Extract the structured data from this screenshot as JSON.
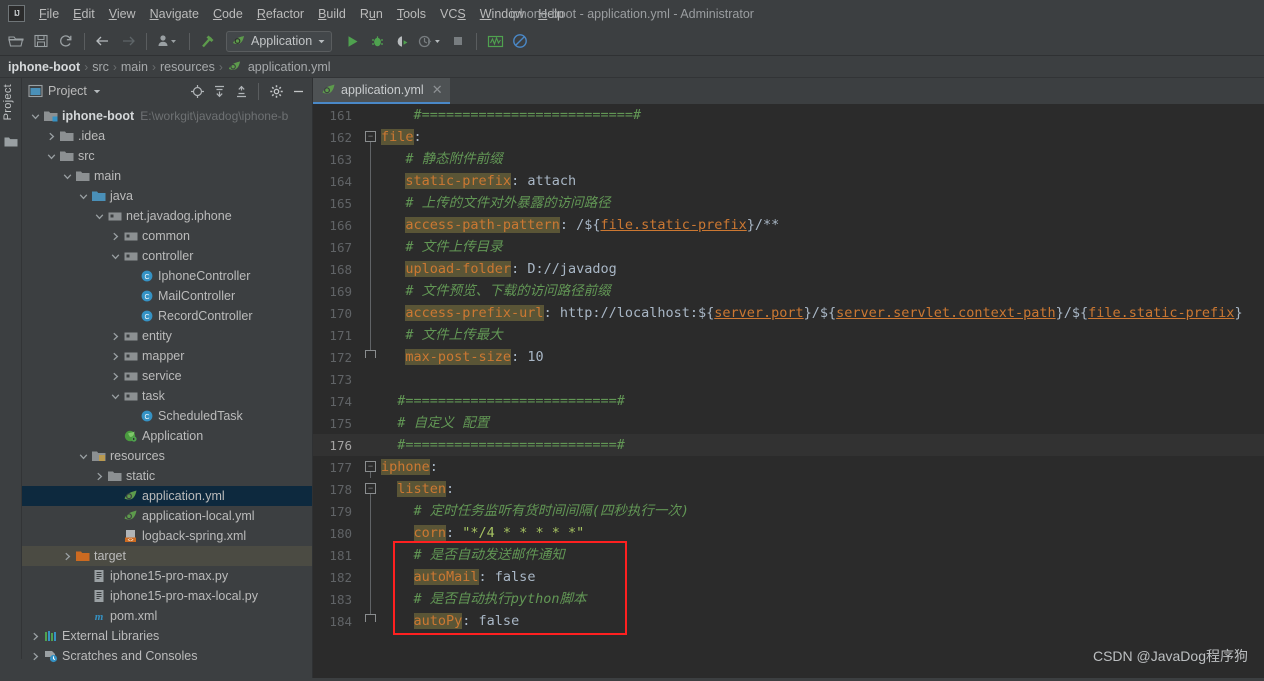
{
  "window": {
    "title": "iphone-boot - application.yml - Administrator"
  },
  "menubar": {
    "logo": "IJ",
    "items": [
      {
        "label": "File",
        "mnemonic": "F"
      },
      {
        "label": "Edit",
        "mnemonic": "E"
      },
      {
        "label": "View",
        "mnemonic": "V"
      },
      {
        "label": "Navigate",
        "mnemonic": "N"
      },
      {
        "label": "Code",
        "mnemonic": "C"
      },
      {
        "label": "Refactor",
        "mnemonic": "R"
      },
      {
        "label": "Build",
        "mnemonic": "B"
      },
      {
        "label": "Run",
        "mnemonic": "u"
      },
      {
        "label": "Tools",
        "mnemonic": "T"
      },
      {
        "label": "VCS",
        "mnemonic": "S"
      },
      {
        "label": "Window",
        "mnemonic": "W"
      },
      {
        "label": "Help",
        "mnemonic": "H"
      }
    ]
  },
  "toolbar": {
    "run_config": "Application",
    "icons": [
      "open-folder-icon",
      "save-all-icon",
      "sync-icon",
      "back-arrow-icon",
      "forward-arrow-icon",
      "profile-user-icon",
      "build-hammer-icon"
    ],
    "run_icons": [
      "run-icon",
      "debug-icon",
      "run-coverage-icon",
      "profiler-icon",
      "stop-icon",
      "monitor-icon",
      "no-entry-icon"
    ]
  },
  "breadcrumb": {
    "items": [
      "iphone-boot",
      "src",
      "main",
      "resources",
      "application.yml"
    ],
    "separator": "›",
    "file_icon": "yaml-leaf-icon"
  },
  "tool_strip": {
    "label": "Project",
    "icon": "folder-icon"
  },
  "project_panel": {
    "title": "Project",
    "dropdown_icon": "chevron-down-icon",
    "actions": [
      "locate-icon",
      "expand-all-icon",
      "collapse-all-icon",
      "settings-gear-icon",
      "hide-icon"
    ],
    "tree": [
      {
        "label": "iphone-boot",
        "path": "E:\\workgit\\javadog\\iphone-b",
        "depth": 0,
        "arrow": "down",
        "icon": "module-icon",
        "bold": true,
        "state": "normal"
      },
      {
        "label": ".idea",
        "depth": 1,
        "arrow": "right",
        "icon": "folder-icon",
        "state": "normal"
      },
      {
        "label": "src",
        "depth": 1,
        "arrow": "down",
        "icon": "folder-icon",
        "state": "normal"
      },
      {
        "label": "main",
        "depth": 2,
        "arrow": "down",
        "icon": "folder-icon",
        "state": "normal"
      },
      {
        "label": "java",
        "depth": 3,
        "arrow": "down",
        "icon": "source-folder-icon",
        "state": "normal"
      },
      {
        "label": "net.javadog.iphone",
        "depth": 4,
        "arrow": "down",
        "icon": "package-icon",
        "state": "normal"
      },
      {
        "label": "common",
        "depth": 5,
        "arrow": "right",
        "icon": "package-icon",
        "state": "normal"
      },
      {
        "label": "controller",
        "depth": 5,
        "arrow": "down",
        "icon": "package-icon",
        "state": "normal"
      },
      {
        "label": "IphoneController",
        "depth": 6,
        "arrow": "none",
        "icon": "java-class-icon",
        "state": "normal"
      },
      {
        "label": "MailController",
        "depth": 6,
        "arrow": "none",
        "icon": "java-class-icon",
        "state": "normal"
      },
      {
        "label": "RecordController",
        "depth": 6,
        "arrow": "none",
        "icon": "java-class-icon",
        "state": "normal"
      },
      {
        "label": "entity",
        "depth": 5,
        "arrow": "right",
        "icon": "package-icon",
        "state": "normal"
      },
      {
        "label": "mapper",
        "depth": 5,
        "arrow": "right",
        "icon": "package-icon",
        "state": "normal"
      },
      {
        "label": "service",
        "depth": 5,
        "arrow": "right",
        "icon": "package-icon",
        "state": "normal"
      },
      {
        "label": "task",
        "depth": 5,
        "arrow": "down",
        "icon": "package-icon",
        "state": "normal"
      },
      {
        "label": "ScheduledTask",
        "depth": 6,
        "arrow": "none",
        "icon": "java-class-icon",
        "state": "normal"
      },
      {
        "label": "Application",
        "depth": 5,
        "arrow": "none",
        "icon": "spring-boot-icon",
        "state": "normal"
      },
      {
        "label": "resources",
        "depth": 3,
        "arrow": "down",
        "icon": "resource-folder-icon",
        "state": "normal"
      },
      {
        "label": "static",
        "depth": 4,
        "arrow": "right",
        "icon": "folder-icon",
        "state": "normal"
      },
      {
        "label": "application.yml",
        "depth": 5,
        "arrow": "none",
        "icon": "yaml-leaf-icon",
        "state": "selected"
      },
      {
        "label": "application-local.yml",
        "depth": 5,
        "arrow": "none",
        "icon": "yaml-leaf-icon",
        "state": "normal"
      },
      {
        "label": "logback-spring.xml",
        "depth": 5,
        "arrow": "none",
        "icon": "xml-file-icon",
        "state": "normal"
      },
      {
        "label": "target",
        "depth": 2,
        "arrow": "right",
        "icon": "target-folder-icon",
        "state": "hover"
      },
      {
        "label": "iphone15-pro-max.py",
        "depth": 3,
        "arrow": "none",
        "icon": "python-file-icon",
        "state": "normal"
      },
      {
        "label": "iphone15-pro-max-local.py",
        "depth": 3,
        "arrow": "none",
        "icon": "python-file-icon",
        "state": "normal"
      },
      {
        "label": "pom.xml",
        "depth": 3,
        "arrow": "none",
        "icon": "maven-icon",
        "state": "normal"
      },
      {
        "label": "External Libraries",
        "depth": 0,
        "arrow": "right",
        "icon": "libraries-icon",
        "state": "normal"
      },
      {
        "label": "Scratches and Consoles",
        "depth": 0,
        "arrow": "right",
        "icon": "scratches-icon",
        "state": "normal"
      }
    ]
  },
  "editor": {
    "tabs": [
      {
        "label": "application.yml",
        "icon": "yaml-leaf-icon",
        "active": true,
        "close_icon": "close-icon"
      }
    ],
    "current_line": 176,
    "lines": [
      {
        "n": 161,
        "fold": "none",
        "tokens": [
          {
            "t": "    ",
            "c": "plain"
          },
          {
            "t": "#==========================#",
            "c": "com"
          }
        ]
      },
      {
        "n": 162,
        "fold": "open",
        "tokens": [
          {
            "t": "file",
            "c": "key"
          },
          {
            "t": ":",
            "c": "punc"
          }
        ]
      },
      {
        "n": 163,
        "fold": "line",
        "tokens": [
          {
            "t": "   ",
            "c": "plain"
          },
          {
            "t": "# 静态附件前缀",
            "c": "com"
          }
        ]
      },
      {
        "n": 164,
        "fold": "line",
        "tokens": [
          {
            "t": "   ",
            "c": "plain"
          },
          {
            "t": "static-prefix",
            "c": "key"
          },
          {
            "t": ": attach",
            "c": "plain"
          }
        ]
      },
      {
        "n": 165,
        "fold": "line",
        "tokens": [
          {
            "t": "   ",
            "c": "plain"
          },
          {
            "t": "# 上传的文件对外暴露的访问路径",
            "c": "com"
          }
        ]
      },
      {
        "n": 166,
        "fold": "line",
        "tokens": [
          {
            "t": "   ",
            "c": "plain"
          },
          {
            "t": "access-path-pattern",
            "c": "key"
          },
          {
            "t": ": /${",
            "c": "plain"
          },
          {
            "t": "file.static-prefix",
            "c": "var"
          },
          {
            "t": "}/**",
            "c": "plain"
          }
        ]
      },
      {
        "n": 167,
        "fold": "line",
        "tokens": [
          {
            "t": "   ",
            "c": "plain"
          },
          {
            "t": "# 文件上传目录",
            "c": "com"
          }
        ]
      },
      {
        "n": 168,
        "fold": "line",
        "tokens": [
          {
            "t": "   ",
            "c": "plain"
          },
          {
            "t": "upload-folder",
            "c": "key"
          },
          {
            "t": ": D://javadog",
            "c": "plain"
          }
        ]
      },
      {
        "n": 169,
        "fold": "line",
        "tokens": [
          {
            "t": "   ",
            "c": "plain"
          },
          {
            "t": "# 文件预览、下载的访问路径前缀",
            "c": "com"
          }
        ]
      },
      {
        "n": 170,
        "fold": "line",
        "tokens": [
          {
            "t": "   ",
            "c": "plain"
          },
          {
            "t": "access-prefix-url",
            "c": "key"
          },
          {
            "t": ": http://localhost:${",
            "c": "plain"
          },
          {
            "t": "server.port",
            "c": "var"
          },
          {
            "t": "}/${",
            "c": "plain"
          },
          {
            "t": "server.servlet.context-path",
            "c": "var"
          },
          {
            "t": "}/${",
            "c": "plain"
          },
          {
            "t": "file.static-prefix",
            "c": "var"
          },
          {
            "t": "}",
            "c": "plain"
          }
        ]
      },
      {
        "n": 171,
        "fold": "line",
        "tokens": [
          {
            "t": "   ",
            "c": "plain"
          },
          {
            "t": "# 文件上传最大",
            "c": "com"
          }
        ]
      },
      {
        "n": 172,
        "fold": "end",
        "tokens": [
          {
            "t": "   ",
            "c": "plain"
          },
          {
            "t": "max-post-size",
            "c": "key"
          },
          {
            "t": ": 10",
            "c": "plain"
          }
        ]
      },
      {
        "n": 173,
        "fold": "none",
        "tokens": []
      },
      {
        "n": 174,
        "fold": "none",
        "tokens": [
          {
            "t": "  ",
            "c": "plain"
          },
          {
            "t": "#==========================#",
            "c": "com"
          }
        ]
      },
      {
        "n": 175,
        "fold": "none",
        "tokens": [
          {
            "t": "  ",
            "c": "plain"
          },
          {
            "t": "# 自定义 配置",
            "c": "com"
          }
        ]
      },
      {
        "n": 176,
        "fold": "none",
        "tokens": [
          {
            "t": "  ",
            "c": "plain"
          },
          {
            "t": "#==========================#",
            "c": "com"
          }
        ]
      },
      {
        "n": 177,
        "fold": "open",
        "tokens": [
          {
            "t": "iphone",
            "c": "key"
          },
          {
            "t": ":",
            "c": "punc"
          }
        ]
      },
      {
        "n": 178,
        "fold": "open2",
        "tokens": [
          {
            "t": "  ",
            "c": "plain"
          },
          {
            "t": "listen",
            "c": "key"
          },
          {
            "t": ":",
            "c": "punc"
          }
        ]
      },
      {
        "n": 179,
        "fold": "line",
        "tokens": [
          {
            "t": "    ",
            "c": "plain"
          },
          {
            "t": "# 定时任务监听有货时间间隔(四秒执行一次)",
            "c": "com"
          }
        ]
      },
      {
        "n": 180,
        "fold": "line",
        "tokens": [
          {
            "t": "    ",
            "c": "plain"
          },
          {
            "t": "corn",
            "c": "key"
          },
          {
            "t": ": ",
            "c": "plain"
          },
          {
            "t": "\"*/4 * * * * *\"",
            "c": "str"
          }
        ]
      },
      {
        "n": 181,
        "fold": "line",
        "tokens": [
          {
            "t": "    ",
            "c": "plain"
          },
          {
            "t": "# 是否自动发送邮件通知",
            "c": "com"
          }
        ]
      },
      {
        "n": 182,
        "fold": "line",
        "tokens": [
          {
            "t": "    ",
            "c": "plain"
          },
          {
            "t": "autoMail",
            "c": "key"
          },
          {
            "t": ": false",
            "c": "plain"
          }
        ]
      },
      {
        "n": 183,
        "fold": "line",
        "tokens": [
          {
            "t": "    ",
            "c": "plain"
          },
          {
            "t": "# 是否自动执行python脚本",
            "c": "com"
          }
        ]
      },
      {
        "n": 184,
        "fold": "end",
        "tokens": [
          {
            "t": "    ",
            "c": "plain"
          },
          {
            "t": "autoPy",
            "c": "key"
          },
          {
            "t": ": false",
            "c": "plain"
          }
        ]
      }
    ],
    "annotation_box": {
      "from_line": 181,
      "to_line": 184,
      "color": "#ff2020"
    }
  },
  "watermark": {
    "text": "CSDN @JavaDog程序狗"
  },
  "colors": {
    "chrome": "#3c3f41",
    "editor_bg": "#2b2b2b",
    "selection": "#0d293e",
    "accent": "#4a88c7",
    "key_bg": "#5a5536",
    "key_fg": "#cc7832",
    "comment": "#629755",
    "string": "#a5c261",
    "annotation": "#ff2020"
  }
}
